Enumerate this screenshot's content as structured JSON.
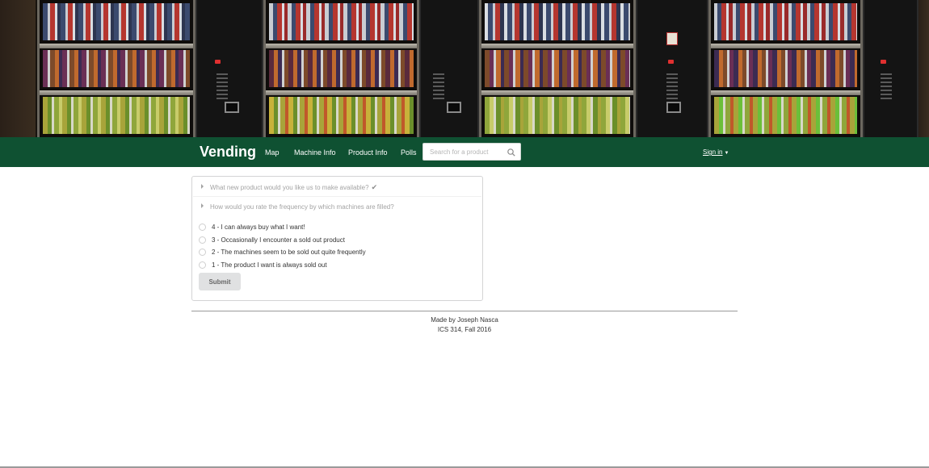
{
  "navbar": {
    "brand": "Vending",
    "links": [
      "Map",
      "Machine Info",
      "Product Info",
      "Polls"
    ],
    "search_placeholder": "Search for a product",
    "search_icon": "search-icon",
    "signin_label": "Sign in",
    "signin_caret": "▼",
    "background_color": "#0f5132"
  },
  "poll": {
    "questions": [
      {
        "text": "What new product would you like us to make available?",
        "answered_mark": "✔"
      },
      {
        "text": "How would you rate the frequency by which machines are filled?"
      }
    ],
    "options": [
      "4 - I can always buy what I want!",
      "3 - Occasionally I encounter a sold out product",
      "2 - The machines seem to be sold out quite frequently",
      "1 - The product I want is always sold out"
    ],
    "submit_label": "Submit"
  },
  "footer": {
    "line1": "Made by Joseph Nasca",
    "line2": "ICS 314, Fall 2016"
  }
}
